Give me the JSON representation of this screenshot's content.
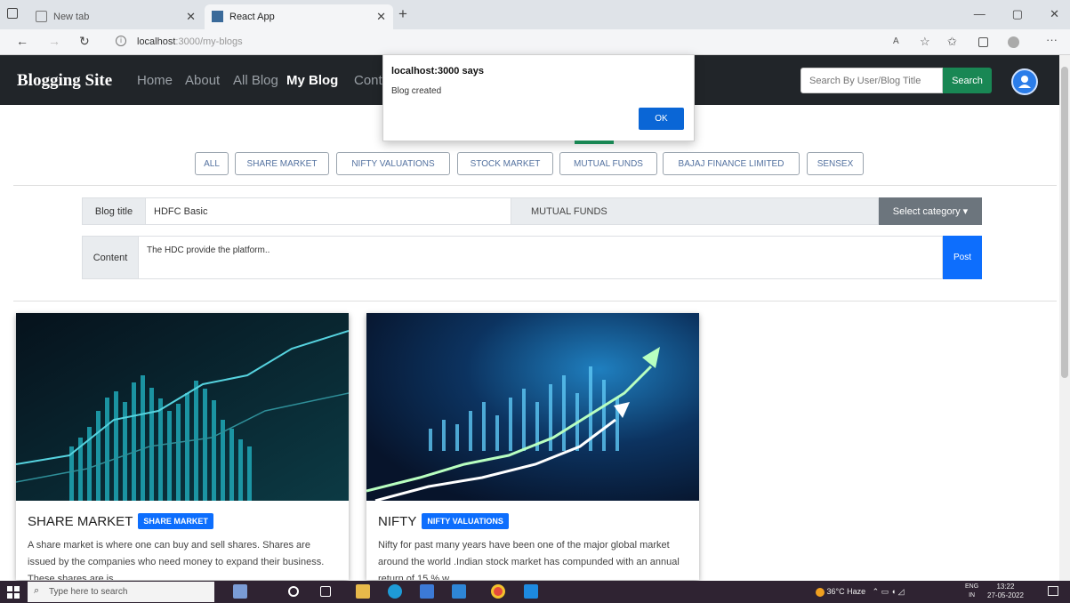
{
  "browser": {
    "tabs": [
      {
        "label": "New tab"
      },
      {
        "label": "React App"
      }
    ],
    "url_host": "localhost",
    "url_path": ":3000/my-blogs",
    "window_controls": [
      "—",
      "▢",
      "✕"
    ]
  },
  "navbar": {
    "brand": "Blogging Site",
    "links": [
      "Home",
      "About",
      "All Blog",
      "My Blog",
      "Cont"
    ],
    "search_placeholder": "Search By User/Blog Title",
    "search_button": "Search"
  },
  "dialog": {
    "title": "localhost:3000 says",
    "message": "Blog created",
    "ok": "OK"
  },
  "categories": [
    "ALL",
    "SHARE MARKET",
    "NIFTY VALUATIONS",
    "STOCK MARKET",
    "MUTUAL FUNDS",
    "BAJAJ FINANCE LIMITED",
    "SENSEX"
  ],
  "form": {
    "title_label": "Blog title",
    "title_value": "HDFC Basic",
    "category_value": "MUTUAL FUNDS",
    "select_category": "Select category ▾",
    "content_label": "Content",
    "content_value": "The HDC provide the platform..",
    "post_button": "Post"
  },
  "cards": [
    {
      "title": "SHARE MARKET",
      "badge": "SHARE MARKET",
      "text": "A share market is where one can buy and sell shares. Shares are issued by the companies who need money to expand their business. These shares are is"
    },
    {
      "title": "NIFTY",
      "badge": "NIFTY VALUATIONS",
      "text": "Nifty for past many years have been one of the major global market around the world .Indian stock market has compunded with an annual return of 15 % w"
    }
  ],
  "taskbar": {
    "search_placeholder": "Type here to search",
    "weather": "36°C  Haze",
    "lang": "ENG",
    "region": "IN",
    "time": "13:22",
    "date": "27-05-2022"
  },
  "colors": {
    "navbar": "#212529",
    "primary": "#0d6efd",
    "success": "#198754",
    "secondary": "#6c757d"
  }
}
